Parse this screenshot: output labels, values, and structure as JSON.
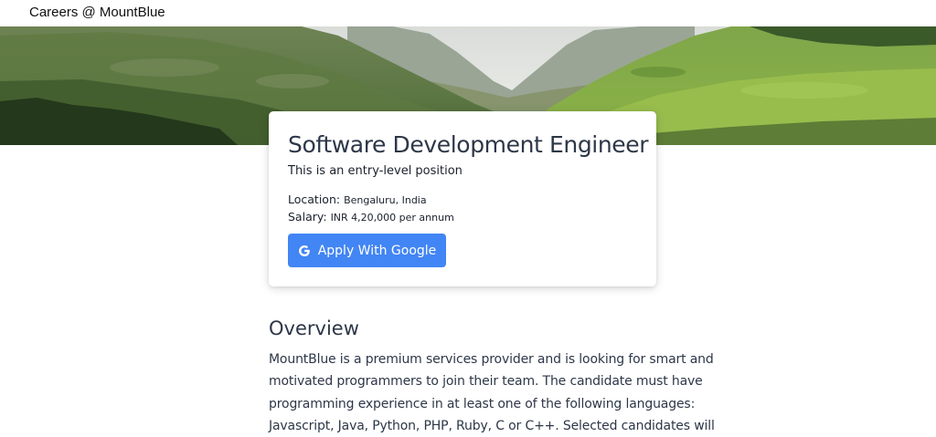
{
  "header": {
    "brand": "Careers @ MountBlue"
  },
  "hero": {
    "image": "mountain-valley-landscape"
  },
  "job": {
    "title": "Software Development Engineer",
    "subtitle": "This is an entry-level position",
    "location_label": "Location:",
    "location_value": "Bengaluru, India",
    "salary_label": "Salary:",
    "salary_value": "INR 4,20,000 per annum",
    "apply_label": "Apply With Google",
    "apply_icon": "google-icon"
  },
  "overview": {
    "heading": "Overview",
    "lines": [
      "MountBlue is a premium services provider and is looking for smart and",
      "motivated programmers to join their team. The candidate must have",
      "programming experience in at least one of the following languages:",
      "Javascript, Java, Python, PHP, Ruby, C or C++. Selected candidates will"
    ]
  },
  "colors": {
    "accent": "#4285f4",
    "text": "#2d3748"
  }
}
